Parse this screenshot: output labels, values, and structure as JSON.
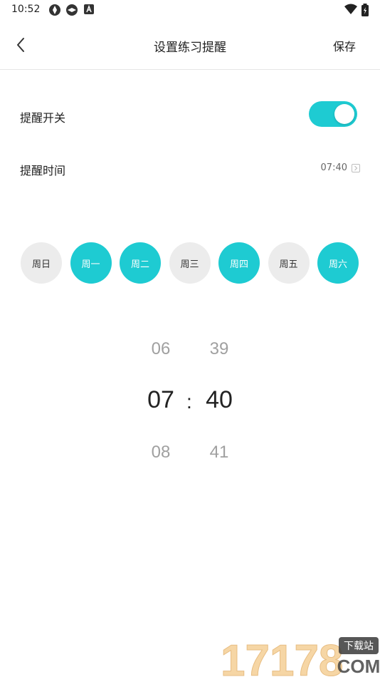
{
  "status_bar": {
    "time": "10:52"
  },
  "header": {
    "title": "设置练习提醒",
    "save_label": "保存"
  },
  "reminder_switch": {
    "label": "提醒开关",
    "enabled": true
  },
  "reminder_time": {
    "label": "提醒时间",
    "value": "07:40"
  },
  "weekdays": [
    {
      "label": "周日",
      "selected": false
    },
    {
      "label": "周一",
      "selected": true
    },
    {
      "label": "周二",
      "selected": true
    },
    {
      "label": "周三",
      "selected": false
    },
    {
      "label": "周四",
      "selected": true
    },
    {
      "label": "周五",
      "selected": false
    },
    {
      "label": "周六",
      "selected": true
    }
  ],
  "picker": {
    "hours": {
      "prev": "06",
      "current": "07",
      "next": "08"
    },
    "minutes": {
      "prev": "39",
      "current": "40",
      "next": "41"
    },
    "separator": ":"
  },
  "colors": {
    "accent": "#1ecbd2",
    "inactive_day": "#ececec"
  },
  "watermark": {
    "text": "17178",
    "suffix": "下载站",
    "domain": "COM"
  }
}
